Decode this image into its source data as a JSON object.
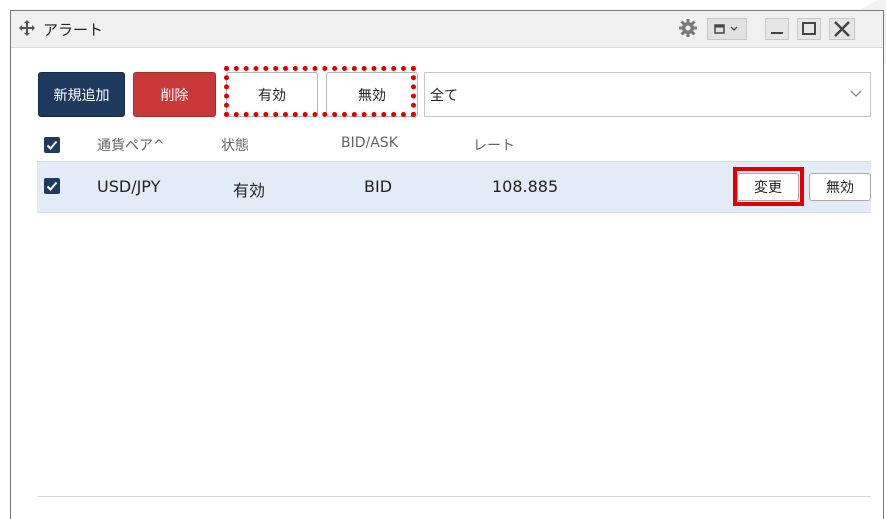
{
  "window": {
    "title": "アラート"
  },
  "toolbar": {
    "add_label": "新規追加",
    "delete_label": "削除",
    "valid_label": "有効",
    "invalid_label": "無効",
    "filter_value": "全て"
  },
  "table": {
    "columns": {
      "pair": "通貨ペア^",
      "status": "状態",
      "bid_ask": "BID/ASK",
      "rate": "レート"
    },
    "rows": [
      {
        "pair": "USD/JPY",
        "status": "有効",
        "bid_ask": "BID",
        "rate": "108.885",
        "change_label": "変更",
        "disable_label": "無効"
      }
    ]
  },
  "colors": {
    "primary": "#1f3a5f",
    "danger": "#c9393a",
    "highlight": "#e00000",
    "row_selected": "#e3ecf6"
  },
  "icons": {
    "move": "move-icon",
    "settings": "gear-icon",
    "layout": "layout-icon",
    "minimize": "minimize-icon",
    "maximize": "maximize-icon",
    "close": "close-icon"
  }
}
